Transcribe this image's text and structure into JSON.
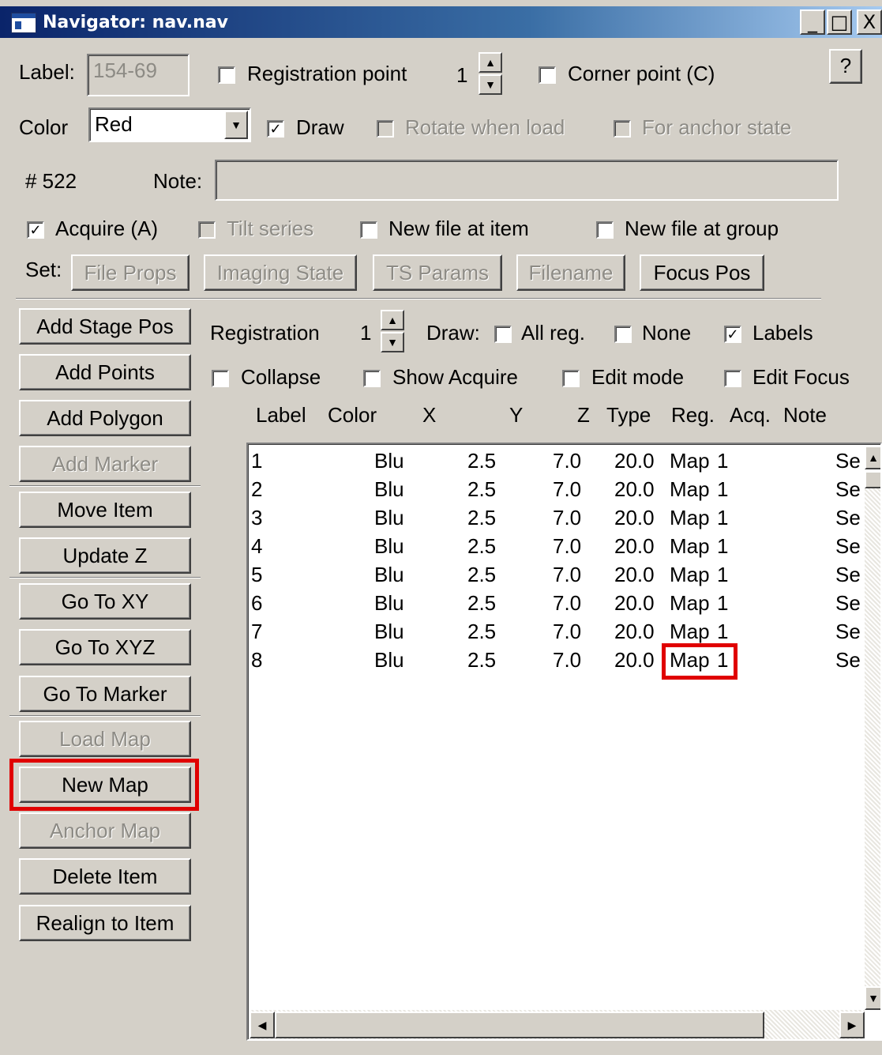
{
  "window": {
    "title": "Navigator:  nav.nav",
    "minimize": "_",
    "maximize": "□",
    "close": "X"
  },
  "top": {
    "label_caption": "Label:",
    "label_value": "154-69",
    "registration_point": "Registration point",
    "reg_value": "1",
    "corner_point": "Corner point (C)",
    "help": "?",
    "color_caption": "Color",
    "color_value": "Red",
    "draw": "Draw",
    "rotate_when_load": "Rotate when load",
    "for_anchor_state": "For anchor state",
    "item_number": "# 522",
    "note_caption": "Note:",
    "note_value": "",
    "acquire": "Acquire (A)",
    "tilt_series": "Tilt series",
    "new_file_at_item": "New file at item",
    "new_file_at_group": "New file at group",
    "set_caption": "Set:",
    "file_props": "File Props",
    "imaging_state": "Imaging State",
    "ts_params": "TS Params",
    "filename": "Filename",
    "focus_pos": "Focus Pos"
  },
  "checks": {
    "registration_point": false,
    "corner_point": false,
    "draw": true,
    "rotate_when_load": false,
    "for_anchor_state": false,
    "acquire": true,
    "tilt_series": false,
    "new_file_at_item": false,
    "new_file_at_group": false,
    "all_reg": false,
    "none": false,
    "labels": true,
    "collapse": false,
    "show_acquire": false,
    "edit_mode": false,
    "edit_focus": false
  },
  "side_buttons": {
    "add_stage_pos": "Add Stage Pos",
    "add_points": "Add Points",
    "add_polygon": "Add Polygon",
    "add_marker": "Add Marker",
    "move_item": "Move Item",
    "update_z": "Update Z",
    "go_to_xy": "Go To XY",
    "go_to_xyz": "Go To XYZ",
    "go_to_marker": "Go To Marker",
    "load_map": "Load Map",
    "new_map": "New Map",
    "anchor_map": "Anchor Map",
    "delete_item": "Delete Item",
    "realign_to_item": "Realign to Item"
  },
  "list_controls": {
    "registration": "Registration",
    "registration_value": "1",
    "draw": "Draw:",
    "all_reg": "All reg.",
    "none": "None",
    "labels": "Labels",
    "collapse": "Collapse",
    "show_acquire": "Show Acquire",
    "edit_mode": "Edit mode",
    "edit_focus": "Edit Focus"
  },
  "columns": {
    "label": "Label",
    "color": "Color",
    "x": "X",
    "y": "Y",
    "z": "Z",
    "type": "Type",
    "reg": "Reg.",
    "acq": "Acq.",
    "note": "Note"
  },
  "rows": [
    {
      "label": "1",
      "color": "Blu",
      "x": "2.5",
      "y": "7.0",
      "z": "20.0",
      "type": "Map",
      "reg": "1",
      "note": "Se"
    },
    {
      "label": "2",
      "color": "Blu",
      "x": "2.5",
      "y": "7.0",
      "z": "20.0",
      "type": "Map",
      "reg": "1",
      "note": "Se"
    },
    {
      "label": "3",
      "color": "Blu",
      "x": "2.5",
      "y": "7.0",
      "z": "20.0",
      "type": "Map",
      "reg": "1",
      "note": "Se"
    },
    {
      "label": "4",
      "color": "Blu",
      "x": "2.5",
      "y": "7.0",
      "z": "20.0",
      "type": "Map",
      "reg": "1",
      "note": "Se"
    },
    {
      "label": "5",
      "color": "Blu",
      "x": "2.5",
      "y": "7.0",
      "z": "20.0",
      "type": "Map",
      "reg": "1",
      "note": "Se"
    },
    {
      "label": "6",
      "color": "Blu",
      "x": "2.5",
      "y": "7.0",
      "z": "20.0",
      "type": "Map",
      "reg": "1",
      "note": "Se"
    },
    {
      "label": "7",
      "color": "Blu",
      "x": "2.5",
      "y": "7.0",
      "z": "20.0",
      "type": "Map",
      "reg": "1",
      "note": "Se"
    },
    {
      "label": "8",
      "color": "Blu",
      "x": "2.5",
      "y": "7.0",
      "z": "20.0",
      "type": "Map",
      "reg": "1",
      "note": "Se"
    }
  ],
  "highlight_color": "#e00000"
}
